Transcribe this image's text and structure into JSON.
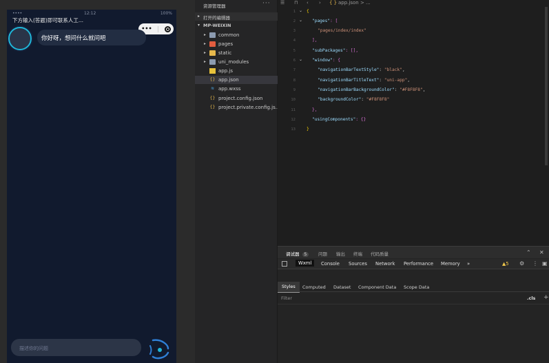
{
  "simulator": {
    "nav_title": "下方输入(答题)即可联系人工...",
    "status_time": "12:12",
    "status_carrier": "••••",
    "status_battery": "100%",
    "capsule_more": "•••",
    "greeting": "你好呀，想问什么就问吧",
    "input_placeholder": "描述你的问题"
  },
  "explorer": {
    "title": "资源管理器",
    "more": "···",
    "open_editors": "打开的编辑器",
    "root": "MP-WEIXIN",
    "items": [
      {
        "label": "common",
        "type": "folder"
      },
      {
        "label": "pages",
        "type": "folder"
      },
      {
        "label": "static",
        "type": "folder"
      },
      {
        "label": "uni_modules",
        "type": "folder"
      },
      {
        "label": "app.js",
        "type": "js"
      },
      {
        "label": "app.json",
        "type": "json"
      },
      {
        "label": "app.wxss",
        "type": "wxss"
      },
      {
        "label": "project.config.json",
        "type": "json"
      },
      {
        "label": "project.private.config.js...",
        "type": "json"
      }
    ]
  },
  "editor": {
    "breadcrumb_icon": "{ }",
    "breadcrumb": "app.json > ...",
    "lines": [
      "1",
      "2",
      "3",
      "4",
      "5",
      "6",
      "7",
      "8",
      "9",
      "10",
      "11",
      "12",
      "13"
    ],
    "code": {
      "l1_open": "{",
      "l2_key": "\"pages\"",
      "l2_rest": ": [",
      "l3_val": "\"pages/index/index\"",
      "l4": "],",
      "l5_key": "\"subPackages\"",
      "l5_rest": ": [],",
      "l6_key": "\"window\"",
      "l6_rest": ": {",
      "l7_key": "\"navigationBarTextStyle\"",
      "l7_val": "\"black\"",
      "l8_key": "\"navigationBarTitleText\"",
      "l8_val": "\"uni-app\"",
      "l9_key": "\"navigationBarBackgroundColor\"",
      "l9_val": "\"#F8F8F8\"",
      "l10_key": "\"backgroundColor\"",
      "l10_val": "\"#F8F8F8\"",
      "l11": "},",
      "l12_key": "\"usingComponents\"",
      "l12_rest": ": {}",
      "l13_close": "}",
      "colon": ": ",
      "comma": ","
    }
  },
  "devtools": {
    "tabs": [
      "调试器",
      "问题",
      "输出",
      "终端",
      "代码质量"
    ],
    "badge": "5",
    "panel_tabs": [
      "Wxml",
      "Console",
      "Sources",
      "Network",
      "Performance",
      "Memory"
    ],
    "more_tabs": "»",
    "warning": "▲5",
    "styles_tabs": [
      "Styles",
      "Computed",
      "Dataset",
      "Component Data",
      "Scope Data"
    ],
    "filter": "Filter",
    "cls": ".cls",
    "plus": "+"
  },
  "colors": {
    "accent": "#1fb6d8",
    "phone_bg": "#111a2e"
  }
}
